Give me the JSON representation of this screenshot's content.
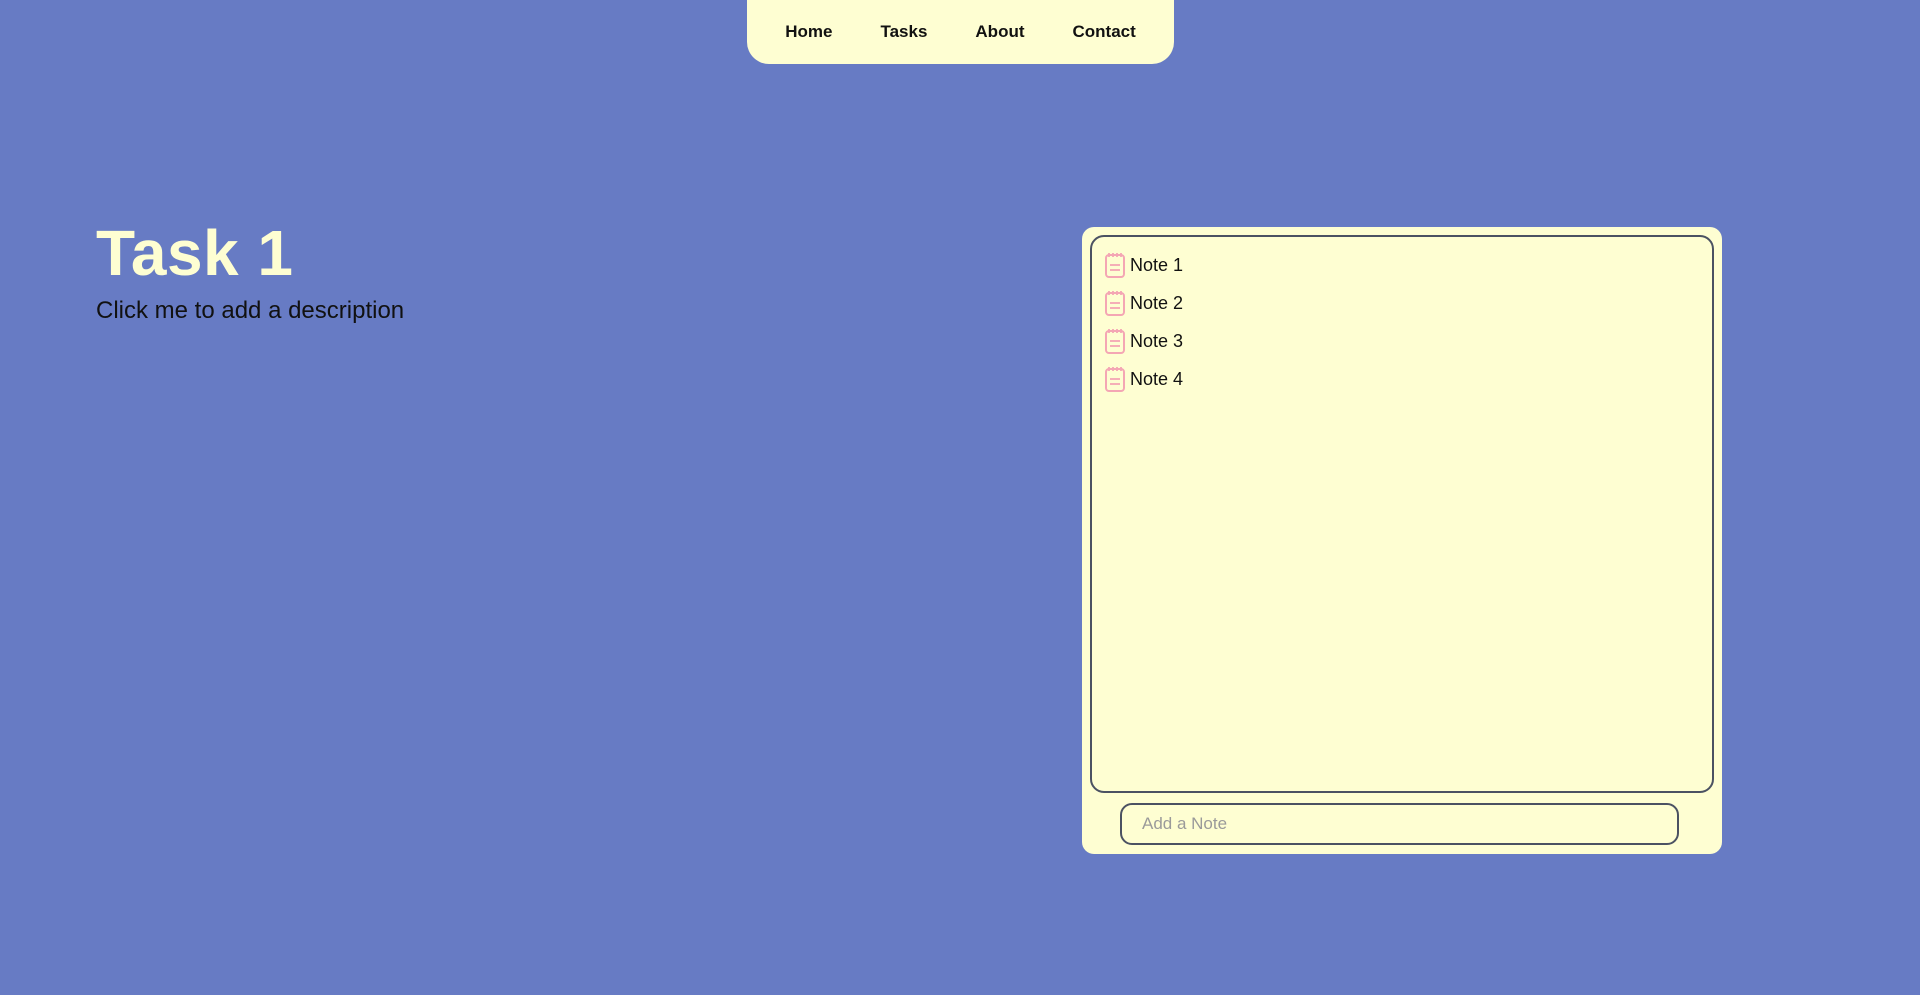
{
  "nav": {
    "items": [
      {
        "label": "Home"
      },
      {
        "label": "Tasks"
      },
      {
        "label": "About"
      },
      {
        "label": "Contact"
      }
    ]
  },
  "task": {
    "title": "Task 1",
    "description": "Click me to add a description"
  },
  "notes": {
    "items": [
      {
        "label": "Note 1",
        "icon": "notepad-icon"
      },
      {
        "label": "Note 2",
        "icon": "notepad-icon"
      },
      {
        "label": "Note 3",
        "icon": "notepad-icon"
      },
      {
        "label": "Note 4",
        "icon": "notepad-icon"
      }
    ],
    "add_placeholder": "Add a Note"
  },
  "colors": {
    "background": "#677bc4",
    "panel": "#fefed2",
    "title": "#fefed2",
    "border": "#4b5262",
    "note_icon": "#f4a6b4"
  }
}
